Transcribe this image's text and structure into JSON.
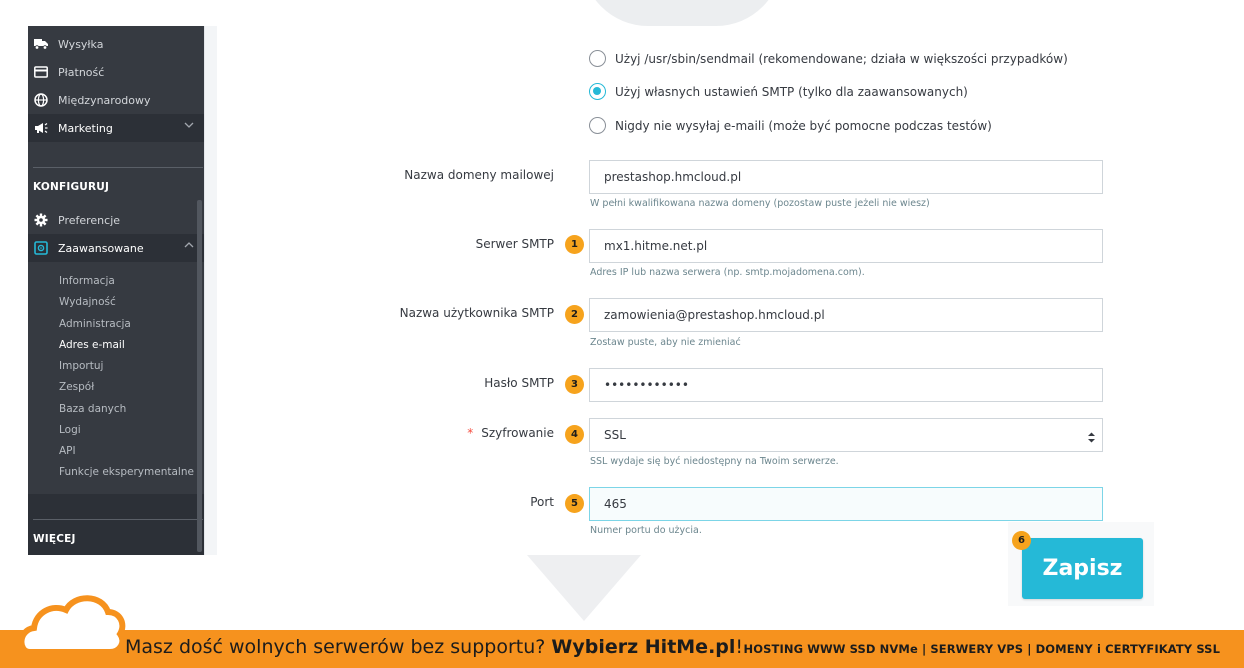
{
  "sidebar": {
    "items": [
      {
        "label": "Wysyłka",
        "icon": "truck-icon"
      },
      {
        "label": "Płatność",
        "icon": "card-icon"
      },
      {
        "label": "Międzynarodowy",
        "icon": "globe-icon"
      },
      {
        "label": "Marketing",
        "icon": "megaphone-icon"
      }
    ],
    "section_configure": "KONFIGURUJ",
    "preferences": "Preferencje",
    "advanced": "Zaawansowane",
    "sub_items": [
      "Informacja",
      "Wydajność",
      "Administracja",
      "Adres e-mail",
      "Importuj",
      "Zespół",
      "Baza danych",
      "Logi",
      "API",
      "Funkcje eksperymentalne"
    ],
    "current_sub_item": "Adres e-mail",
    "section_more": "WIĘCEJ"
  },
  "mail_options": [
    {
      "label": "Użyj /usr/sbin/sendmail (rekomendowane; działa w większości przypadków)",
      "checked": false
    },
    {
      "label": "Użyj własnych ustawień SMTP (tylko dla zaawansowanych)",
      "checked": true
    },
    {
      "label": "Nigdy nie wysyłaj e-maili (może być pomocne podczas testów)",
      "checked": false
    }
  ],
  "form": {
    "domain": {
      "label": "Nazwa domeny mailowej",
      "value": "prestashop.hmcloud.pl",
      "hint": "W pełni kwalifikowana nazwa domeny (pozostaw puste jeżeli nie wiesz)"
    },
    "server": {
      "label": "Serwer SMTP",
      "badge": "1",
      "value": "mx1.hitme.net.pl",
      "hint": "Adres IP lub nazwa serwera (np. smtp.mojadomena.com)."
    },
    "user": {
      "label": "Nazwa użytkownika SMTP",
      "badge": "2",
      "value": "zamowienia@prestashop.hmcloud.pl",
      "hint": "Zostaw puste, aby nie zmieniać"
    },
    "password": {
      "label": "Hasło SMTP",
      "badge": "3",
      "value": "••••••••••••"
    },
    "encryption": {
      "required_mark": "*",
      "label": "Szyfrowanie",
      "badge": "4",
      "value": "SSL",
      "hint": "SSL wydaje się być niedostępny na Twoim serwerze."
    },
    "port": {
      "label": "Port",
      "badge": "5",
      "value": "465",
      "hint": "Numer portu do użycia."
    }
  },
  "save": {
    "label": "Zapisz",
    "badge": "6"
  },
  "footer": {
    "text_before": "Masz dość wolnych serwerów bez supportu? ",
    "brand": "Wybierz HitMe.pl",
    "text_after": "!",
    "services": "HOSTING WWW SSD NVMe | SERWERY VPS | DOMENY i CERTYFIKATY SSL"
  },
  "colors": {
    "accent": "#25b9d7",
    "badge": "#f6a31d",
    "footer": "#f6921e",
    "sidebar": "#363a41"
  }
}
